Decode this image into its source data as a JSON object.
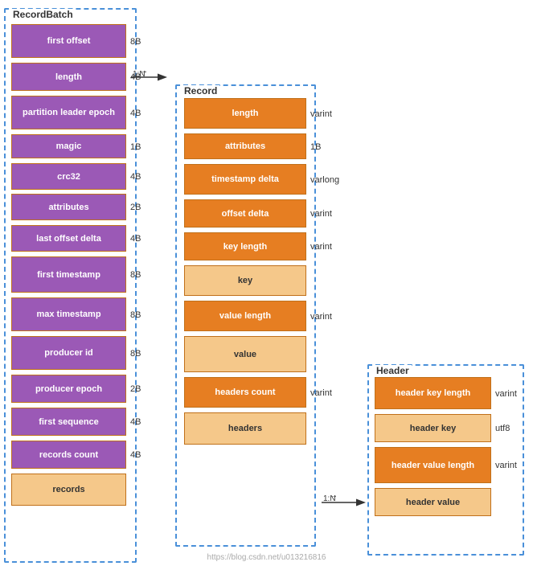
{
  "recordbatch": {
    "title": "RecordBatch",
    "fields": [
      {
        "label": "first offset",
        "size": "8B",
        "color": "purple"
      },
      {
        "label": "length",
        "size": "4B",
        "color": "purple"
      },
      {
        "label": "partition leader epoch",
        "size": "4B",
        "color": "purple"
      },
      {
        "label": "magic",
        "size": "1B",
        "color": "purple"
      },
      {
        "label": "crc32",
        "size": "4B",
        "color": "purple"
      },
      {
        "label": "attributes",
        "size": "2B",
        "color": "purple"
      },
      {
        "label": "last offset delta",
        "size": "4B",
        "color": "purple"
      },
      {
        "label": "first timestamp",
        "size": "8B",
        "color": "purple"
      },
      {
        "label": "max timestamp",
        "size": "8B",
        "color": "purple"
      },
      {
        "label": "producer id",
        "size": "8B",
        "color": "purple"
      },
      {
        "label": "producer epoch",
        "size": "2B",
        "color": "purple"
      },
      {
        "label": "first sequence",
        "size": "4B",
        "color": "purple"
      },
      {
        "label": "records count",
        "size": "4B",
        "color": "purple"
      },
      {
        "label": "records",
        "size": "",
        "color": "peach"
      }
    ]
  },
  "record": {
    "title": "Record",
    "fields": [
      {
        "label": "length",
        "size": "varint",
        "color": "orange-dark"
      },
      {
        "label": "attributes",
        "size": "1B",
        "color": "orange-dark"
      },
      {
        "label": "timestamp delta",
        "size": "varlong",
        "color": "orange-dark"
      },
      {
        "label": "offset delta",
        "size": "varint",
        "color": "orange-dark"
      },
      {
        "label": "key length",
        "size": "varint",
        "color": "orange-dark"
      },
      {
        "label": "key",
        "size": "",
        "color": "peach"
      },
      {
        "label": "value length",
        "size": "varint",
        "color": "orange-dark"
      },
      {
        "label": "value",
        "size": "",
        "color": "peach"
      },
      {
        "label": "headers count",
        "size": "varint",
        "color": "orange-dark"
      },
      {
        "label": "headers",
        "size": "",
        "color": "peach"
      }
    ]
  },
  "header": {
    "title": "Header",
    "fields": [
      {
        "label": "header key length",
        "size": "varint",
        "color": "orange-dark"
      },
      {
        "label": "header key",
        "size": "utf8",
        "color": "peach"
      },
      {
        "label": "header value length",
        "size": "varint",
        "color": "orange-dark"
      },
      {
        "label": "header value",
        "size": "",
        "color": "peach"
      }
    ]
  },
  "arrows": {
    "rb_to_record": "1:N",
    "record_to_header": "1:N"
  }
}
